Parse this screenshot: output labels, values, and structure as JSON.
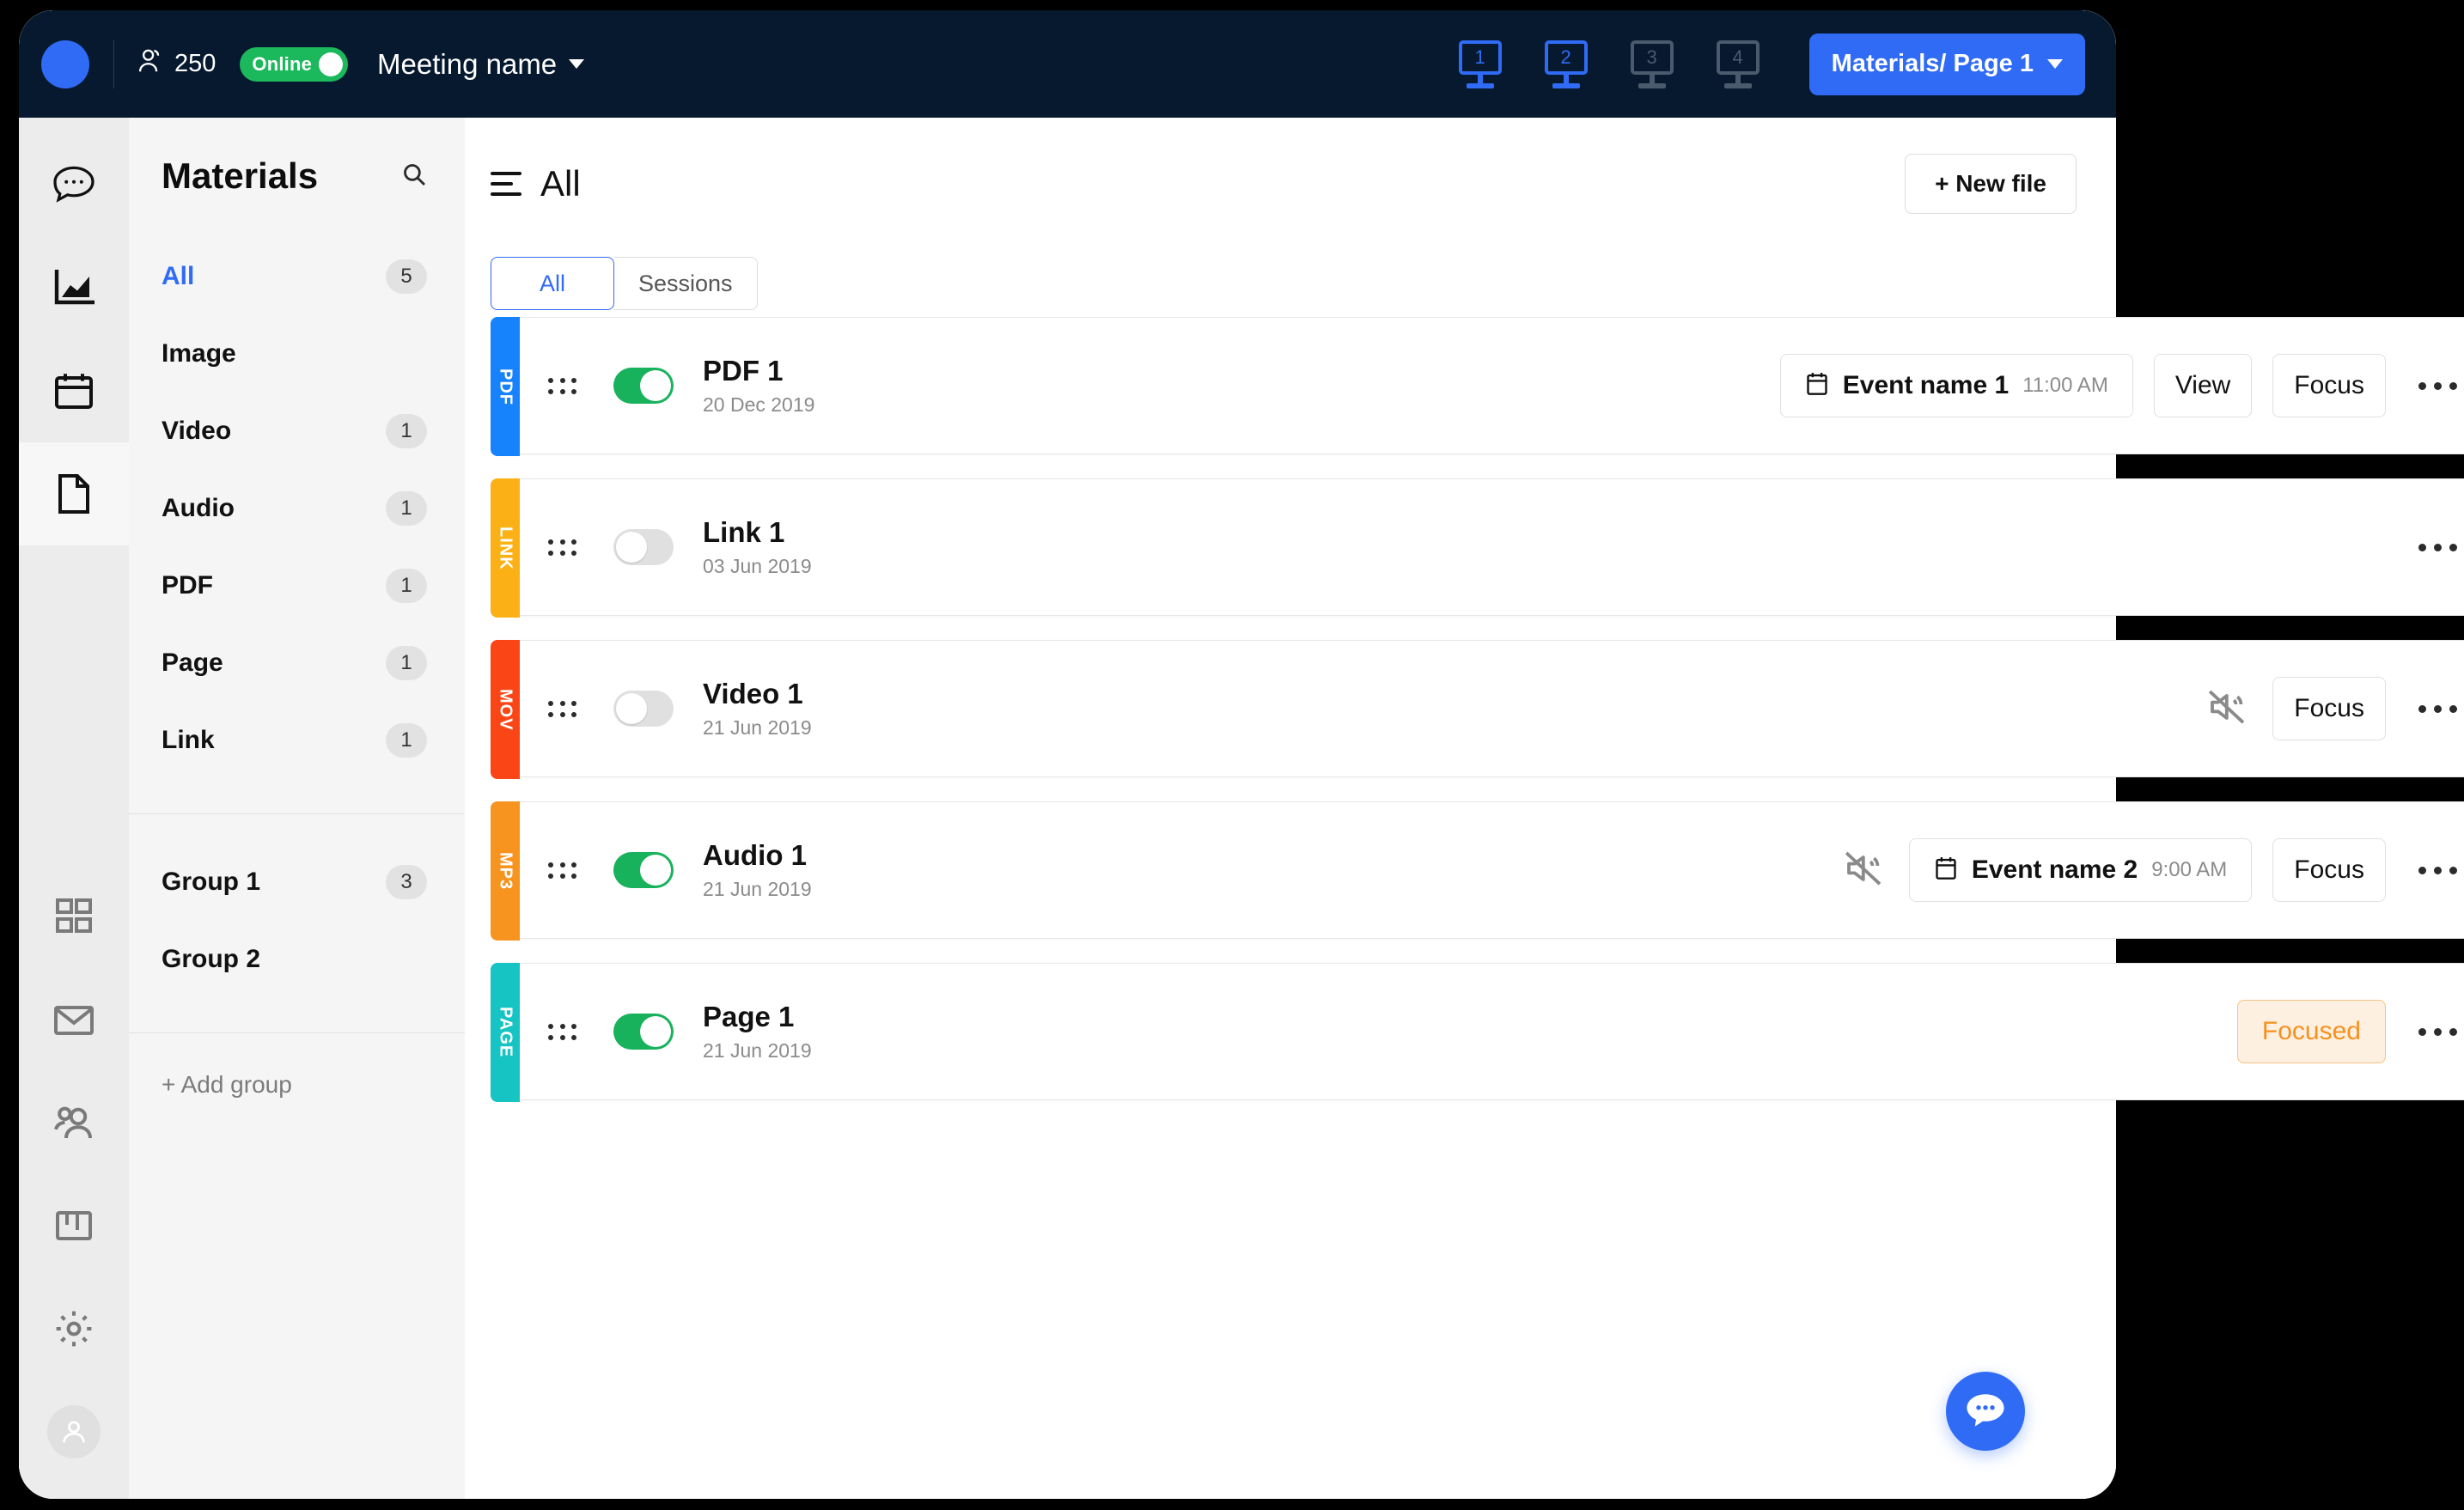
{
  "topbar": {
    "people_count": "250",
    "status_label": "Online",
    "meeting_name": "Meeting name",
    "screens": [
      {
        "label": "1",
        "active": true
      },
      {
        "label": "2",
        "active": true
      },
      {
        "label": "3",
        "active": false
      },
      {
        "label": "4",
        "active": false
      }
    ],
    "page_button_label": "Materials/ Page 1"
  },
  "rail": {
    "items_top": [
      {
        "name": "chat-icon"
      },
      {
        "name": "analytics-icon"
      },
      {
        "name": "calendar-icon"
      },
      {
        "name": "document-icon"
      }
    ],
    "items_bottom": [
      {
        "name": "grid-icon"
      },
      {
        "name": "mail-icon"
      },
      {
        "name": "people-icon"
      },
      {
        "name": "board-icon"
      },
      {
        "name": "gear-icon"
      },
      {
        "name": "avatar-icon"
      }
    ]
  },
  "sidebar": {
    "title": "Materials",
    "search_icon": "search-icon",
    "types": [
      {
        "label": "All",
        "count": "5",
        "active": true
      },
      {
        "label": "Image",
        "count": "",
        "active": false
      },
      {
        "label": "Video",
        "count": "1",
        "active": false
      },
      {
        "label": "Audio",
        "count": "1",
        "active": false
      },
      {
        "label": "PDF",
        "count": "1",
        "active": false
      },
      {
        "label": "Page",
        "count": "1",
        "active": false
      },
      {
        "label": "Link",
        "count": "1",
        "active": false
      }
    ],
    "groups": [
      {
        "label": "Group 1",
        "count": "3"
      },
      {
        "label": "Group 2",
        "count": ""
      }
    ],
    "add_group_label": "+ Add group"
  },
  "main": {
    "title": "All",
    "new_file_label": "+ New file",
    "tabs": [
      {
        "label": "All",
        "active": true
      },
      {
        "label": "Sessions",
        "active": false
      }
    ],
    "files": [
      {
        "type_tag": "PDF",
        "tag_color": "#1682fb",
        "toggle": "on",
        "name": "PDF 1",
        "date": "20 Dec 2019",
        "muted": false,
        "event_name": "Event name 1",
        "event_time": "11:00 AM",
        "view_label": "View",
        "focus_label": "Focus",
        "focused_label": ""
      },
      {
        "type_tag": "LINK",
        "tag_color": "#fbb116",
        "toggle": "off",
        "name": "Link 1",
        "date": "03 Jun 2019",
        "muted": false,
        "event_name": "",
        "event_time": "",
        "view_label": "",
        "focus_label": "",
        "focused_label": ""
      },
      {
        "type_tag": "MOV",
        "tag_color": "#fa4616",
        "toggle": "off",
        "name": "Video 1",
        "date": "21 Jun 2019",
        "muted": true,
        "event_name": "",
        "event_time": "",
        "view_label": "",
        "focus_label": "Focus",
        "focused_label": ""
      },
      {
        "type_tag": "MP3",
        "tag_color": "#f79420",
        "toggle": "on",
        "name": "Audio 1",
        "date": "21 Jun 2019",
        "muted": true,
        "event_name": "Event name 2",
        "event_time": "9:00 AM",
        "view_label": "",
        "focus_label": "Focus",
        "focused_label": ""
      },
      {
        "type_tag": "PAGE",
        "tag_color": "#16c4c4",
        "toggle": "on",
        "name": "Page 1",
        "date": "21 Jun 2019",
        "muted": false,
        "event_name": "",
        "event_time": "",
        "view_label": "",
        "focus_label": "",
        "focused_label": "Focused"
      }
    ]
  },
  "fab": {
    "icon": "chat-bubble-icon"
  },
  "colors": {
    "accent": "#2f6bf5",
    "topbar_bg": "#06192f",
    "online_green": "#1cb85c",
    "toggle_on": "#19b25c",
    "focused_orange": "#f7901e"
  }
}
